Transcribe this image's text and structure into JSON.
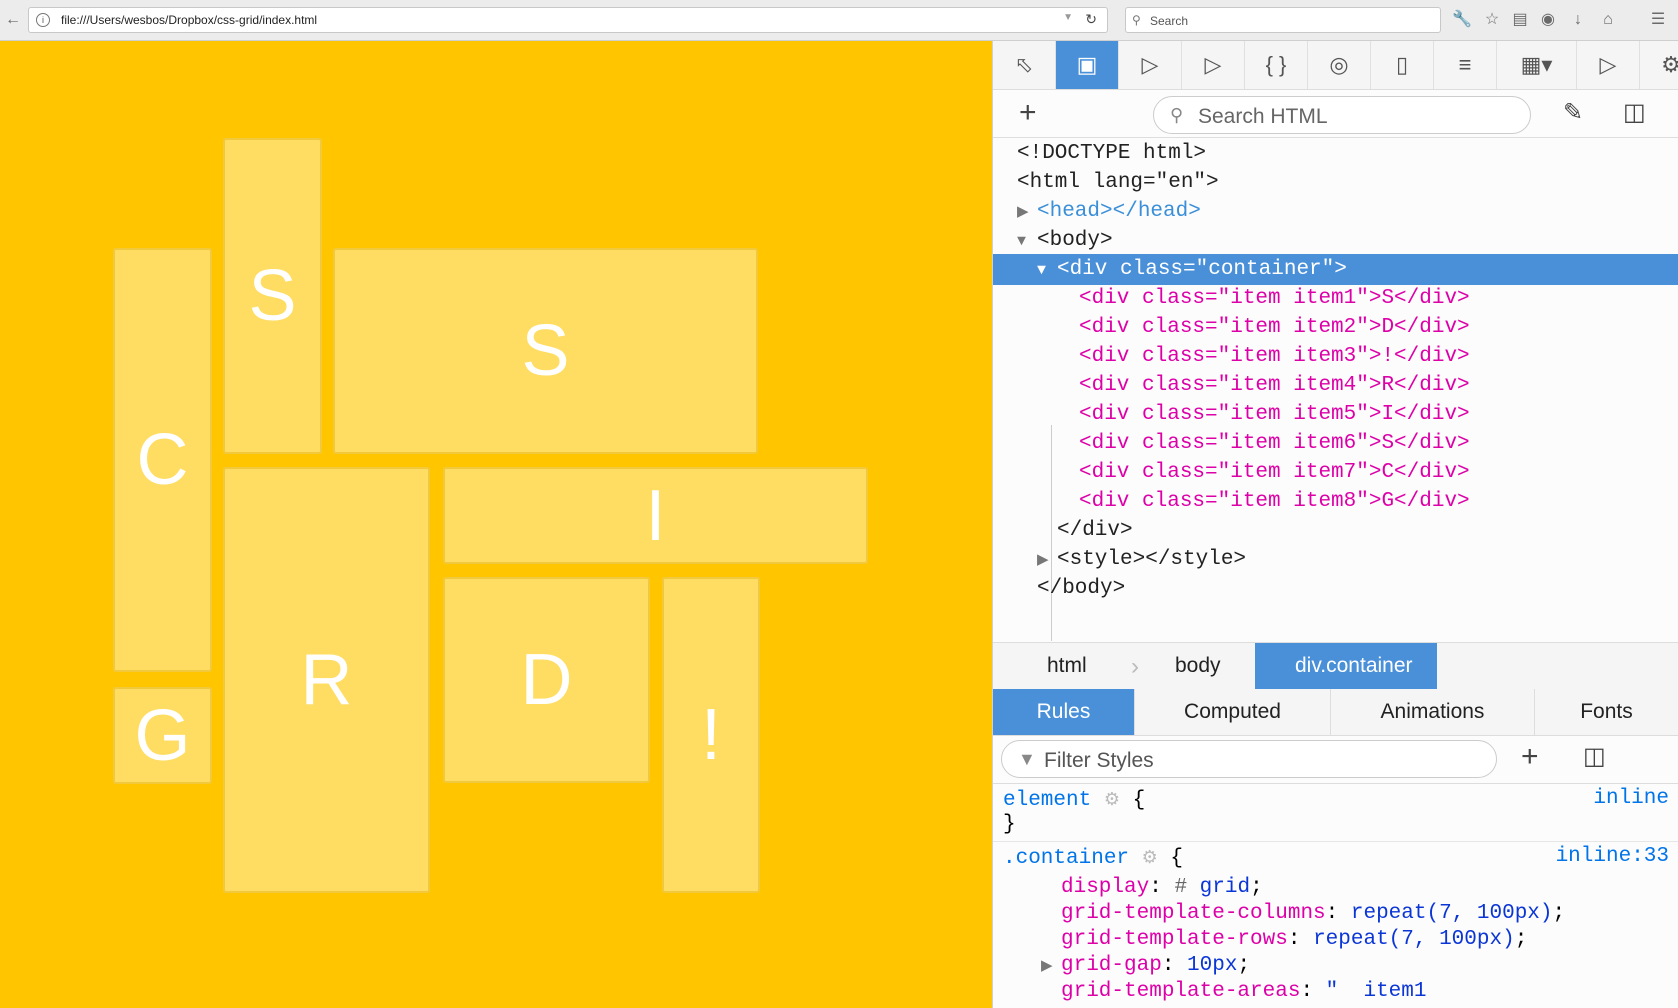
{
  "browser": {
    "url": "file:///Users/wesbos/Dropbox/css-grid/index.html",
    "search_placeholder": "Search"
  },
  "page": {
    "background": "#ffc600",
    "items": [
      {
        "name": "item1",
        "letter": "C"
      },
      {
        "name": "item2",
        "letter": "S"
      },
      {
        "name": "item3",
        "letter": "S"
      },
      {
        "name": "item4",
        "letter": "I"
      },
      {
        "name": "item5",
        "letter": "R"
      },
      {
        "name": "item6",
        "letter": "D"
      },
      {
        "name": "item7",
        "letter": "!"
      },
      {
        "name": "item8",
        "letter": "G"
      }
    ]
  },
  "devtools": {
    "search_html_placeholder": "Search HTML",
    "markup": {
      "doctype": "<!DOCTYPE html>",
      "html_open": "<html lang=\"en\">",
      "head": "<head></head>",
      "body_open": "<body>",
      "container_open": "<div class=\"container\">",
      "children": [
        "<div class=\"item item1\">S</div>",
        "<div class=\"item item2\">D</div>",
        "<div class=\"item item3\">!</div>",
        "<div class=\"item item4\">R</div>",
        "<div class=\"item item5\">I</div>",
        "<div class=\"item item6\">S</div>",
        "<div class=\"item item7\">C</div>",
        "<div class=\"item item8\">G</div>"
      ],
      "container_close": "</div>",
      "style": "<style></style>",
      "body_close": "</body>"
    },
    "breadcrumbs": [
      "html",
      "body",
      "div.container"
    ],
    "panel_tabs": [
      "Rules",
      "Computed",
      "Animations",
      "Fonts"
    ],
    "filter_placeholder": "Filter Styles",
    "rules": {
      "element_selector": "element",
      "element_source": "inline",
      "open_brace": "{",
      "close_brace": "}",
      "container_selector": ".container",
      "container_source": "inline:33",
      "declarations": [
        {
          "prop": "display",
          "value": "grid"
        },
        {
          "prop": "grid-template-columns",
          "value": "repeat(7, 100px)"
        },
        {
          "prop": "grid-template-rows",
          "value": "repeat(7, 100px)"
        },
        {
          "prop": "grid-gap",
          "value": "10px"
        },
        {
          "prop": "grid-template-areas",
          "value": "\"  item1"
        }
      ]
    }
  }
}
